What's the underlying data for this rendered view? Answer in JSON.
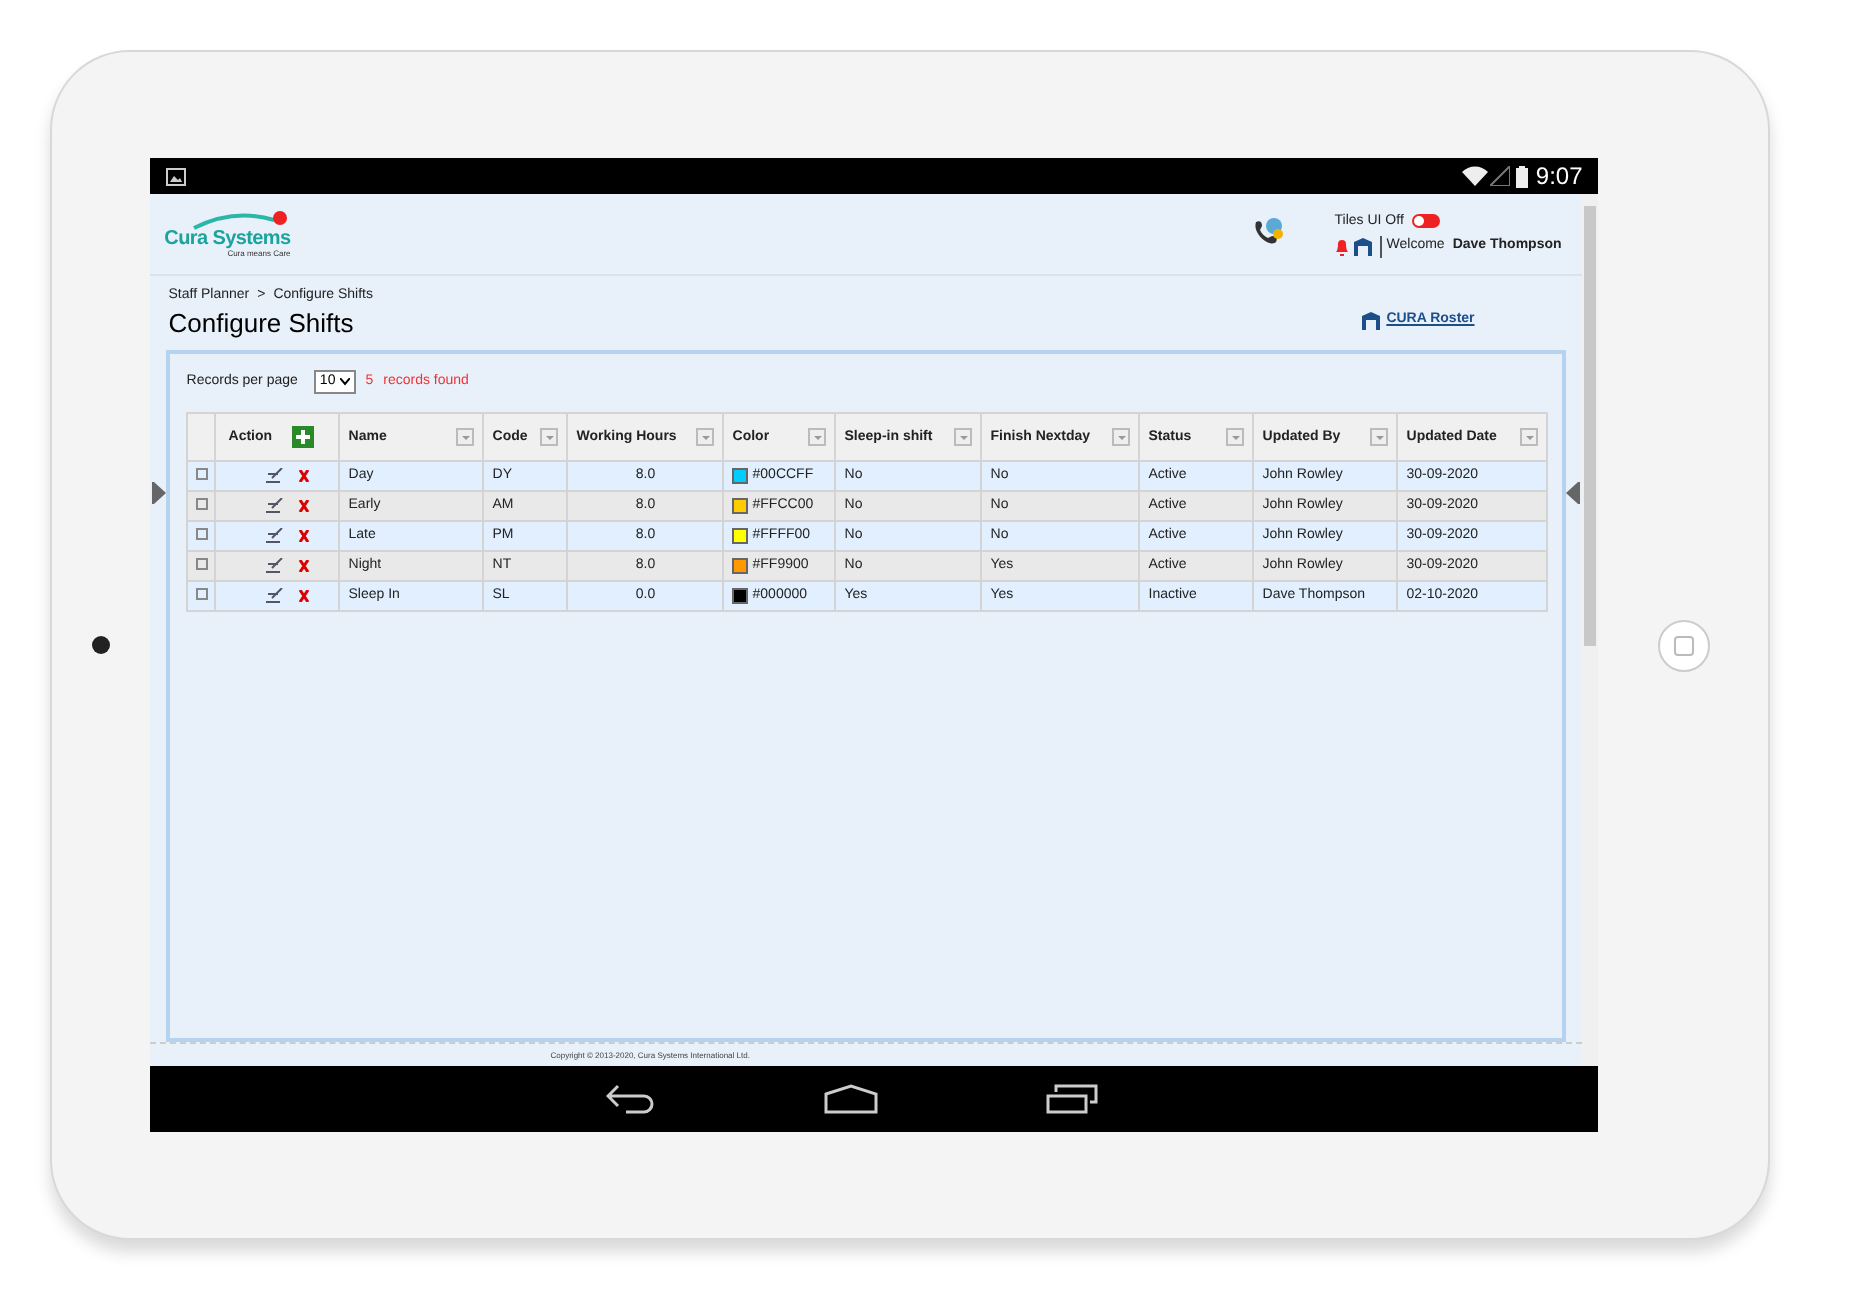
{
  "status_bar": {
    "time": "9:07"
  },
  "header": {
    "logo_name": "Cura Systems",
    "logo_tagline": "Cura means Care",
    "tiles_toggle": {
      "label": "Tiles UI Off",
      "on": false
    },
    "welcome_label": "Welcome",
    "user": "Dave Thompson"
  },
  "breadcrumb": [
    "Staff Planner",
    ">",
    "Configure Shifts"
  ],
  "page_title": "Configure Shifts",
  "roster_link": "CURA Roster",
  "pager": {
    "label": "Records per page",
    "value": "10",
    "count": "5",
    "count_label": "records found"
  },
  "table": {
    "columns": [
      "Action",
      "Name",
      "Code",
      "Working Hours",
      "Color",
      "Sleep-in shift",
      "Finish Nextday",
      "Status",
      "Updated By",
      "Updated Date"
    ],
    "rows": [
      {
        "name": "Day",
        "code": "DY",
        "hours": "8.0",
        "color": "#00ccff",
        "color_text": "#00CCFF",
        "sleep_in": "No",
        "finish_nextday": "No",
        "status": "Active",
        "updated_by": "John Rowley",
        "updated_date": "30-09-2020"
      },
      {
        "name": "Early",
        "code": "AM",
        "hours": "8.0",
        "color": "#ffcc00",
        "color_text": "#FFCC00",
        "sleep_in": "No",
        "finish_nextday": "No",
        "status": "Active",
        "updated_by": "John Rowley",
        "updated_date": "30-09-2020"
      },
      {
        "name": "Late",
        "code": "PM",
        "hours": "8.0",
        "color": "#ffff00",
        "color_text": "#FFFF00",
        "sleep_in": "No",
        "finish_nextday": "No",
        "status": "Active",
        "updated_by": "John Rowley",
        "updated_date": "30-09-2020"
      },
      {
        "name": "Night",
        "code": "NT",
        "hours": "8.0",
        "color": "#ff9900",
        "color_text": "#FF9900",
        "sleep_in": "No",
        "finish_nextday": "Yes",
        "status": "Active",
        "updated_by": "John Rowley",
        "updated_date": "30-09-2020"
      },
      {
        "name": "Sleep In",
        "code": "SL",
        "hours": "0.0",
        "color": "#000000",
        "color_text": "#000000",
        "sleep_in": "Yes",
        "finish_nextday": "Yes",
        "status": "Inactive",
        "updated_by": "Dave Thompson",
        "updated_date": "02-10-2020"
      }
    ]
  },
  "footer": {
    "copyright": "Copyright © 2013-2020, Cura Systems International Ltd."
  }
}
